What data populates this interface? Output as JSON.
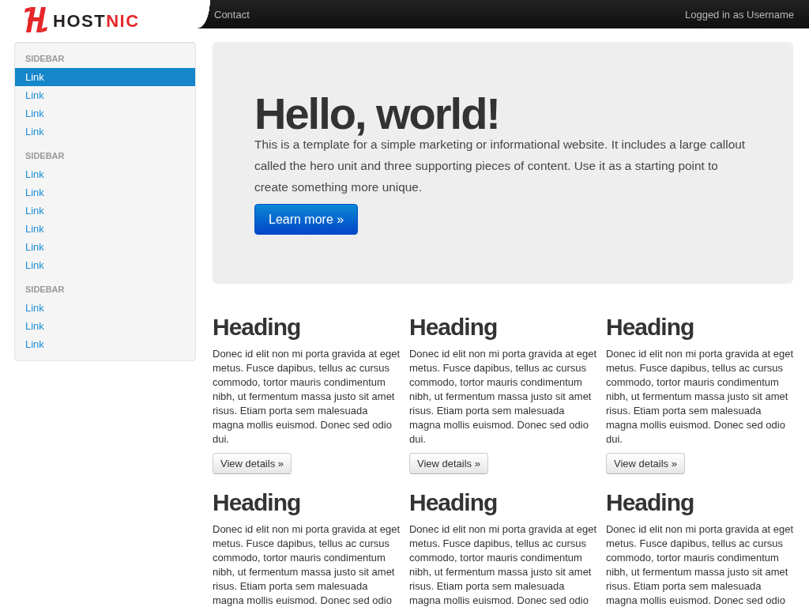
{
  "brand": {
    "name": "HOST",
    "accent": "NIC"
  },
  "navbar": {
    "links": [
      {
        "label": "Contact"
      }
    ],
    "status": "Logged in as Username"
  },
  "sidebar": {
    "sections": [
      {
        "header": "SIDEBAR",
        "items": [
          {
            "label": "Link",
            "selected": true
          },
          {
            "label": "Link",
            "selected": false
          },
          {
            "label": "Link",
            "selected": false
          },
          {
            "label": "Link",
            "selected": false
          }
        ]
      },
      {
        "header": "SIDEBAR",
        "items": [
          {
            "label": "Link",
            "selected": false
          },
          {
            "label": "Link",
            "selected": false
          },
          {
            "label": "Link",
            "selected": false
          },
          {
            "label": "Link",
            "selected": false
          },
          {
            "label": "Link",
            "selected": false
          },
          {
            "label": "Link",
            "selected": false
          }
        ]
      },
      {
        "header": "SIDEBAR",
        "items": [
          {
            "label": "Link",
            "selected": false
          },
          {
            "label": "Link",
            "selected": false
          },
          {
            "label": "Link",
            "selected": false
          }
        ]
      }
    ]
  },
  "hero": {
    "title": "Hello, world!",
    "text": "This is a template for a simple marketing or informational website. It includes a large callout called the hero unit and three supporting pieces of content. Use it as a starting point to create something more unique.",
    "button": "Learn more »"
  },
  "features": [
    {
      "heading": "Heading",
      "text": "Donec id elit non mi porta gravida at eget metus. Fusce dapibus, tellus ac cursus commodo, tortor mauris condimentum nibh, ut fermentum massa justo sit amet risus. Etiam porta sem malesuada magna mollis euismod. Donec sed odio dui.",
      "button": "View details »"
    },
    {
      "heading": "Heading",
      "text": "Donec id elit non mi porta gravida at eget metus. Fusce dapibus, tellus ac cursus commodo, tortor mauris condimentum nibh, ut fermentum massa justo sit amet risus. Etiam porta sem malesuada magna mollis euismod. Donec sed odio dui.",
      "button": "View details »"
    },
    {
      "heading": "Heading",
      "text": "Donec id elit non mi porta gravida at eget metus. Fusce dapibus, tellus ac cursus commodo, tortor mauris condimentum nibh, ut fermentum massa justo sit amet risus. Etiam porta sem malesuada magna mollis euismod. Donec sed odio dui.",
      "button": "View details »"
    },
    {
      "heading": "Heading",
      "text": "Donec id elit non mi porta gravida at eget metus. Fusce dapibus, tellus ac cursus commodo, tortor mauris condimentum nibh, ut fermentum massa justo sit amet risus. Etiam porta sem malesuada magna mollis euismod. Donec sed odio"
    },
    {
      "heading": "Heading",
      "text": "Donec id elit non mi porta gravida at eget metus. Fusce dapibus, tellus ac cursus commodo, tortor mauris condimentum nibh, ut fermentum massa justo sit amet risus. Etiam porta sem malesuada magna mollis euismod. Donec sed odio"
    },
    {
      "heading": "Heading",
      "text": "Donec id elit non mi porta gravida at eget metus. Fusce dapibus, tellus ac cursus commodo, tortor mauris condimentum nibh, ut fermentum massa justo sit amet risus. Etiam porta sem malesuada magna mollis euismod. Donec sed odio"
    }
  ]
}
